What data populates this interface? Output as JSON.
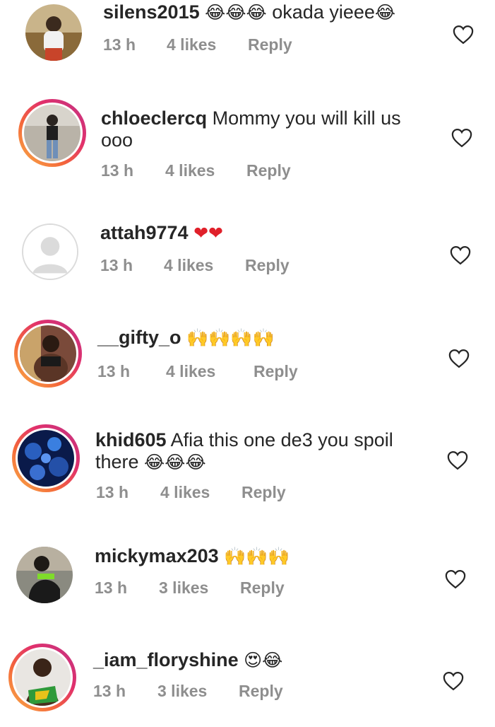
{
  "comments": [
    {
      "username": "silens2015",
      "text": " ",
      "emoji1": "😂😂😂",
      "text2": " okada yieee",
      "emoji2": "😂",
      "time": "13 h",
      "likes": "4 likes",
      "reply": "Reply"
    },
    {
      "username": "chloeclercq",
      "text": " Mommy you will kill us ooo",
      "emoji1": "",
      "text2": "",
      "emoji2": "",
      "time": "13 h",
      "likes": "4 likes",
      "reply": "Reply"
    },
    {
      "username": "attah9774",
      "text": " ",
      "emoji1": "❤❤",
      "text2": "",
      "emoji2": "",
      "time": "13 h",
      "likes": "4 likes",
      "reply": "Reply"
    },
    {
      "username": "__gifty_o",
      "text": " ",
      "emoji1": "🙌🙌🙌🙌",
      "text2": "",
      "emoji2": "",
      "time": "13 h",
      "likes": "4 likes",
      "reply": "Reply"
    },
    {
      "username": "khid605",
      "text": " Afia this one de3 you spoil there ",
      "emoji1": "😂😂😂",
      "text2": "",
      "emoji2": "",
      "time": "13 h",
      "likes": "4 likes",
      "reply": "Reply"
    },
    {
      "username": "mickymax203",
      "text": " ",
      "emoji1": "🙌🙌🙌",
      "text2": "",
      "emoji2": "",
      "time": "13 h",
      "likes": "3 likes",
      "reply": "Reply"
    },
    {
      "username": "_iam_floryshine",
      "text": " ",
      "emoji1": "😍😂",
      "text2": "",
      "emoji2": "",
      "time": "13 h",
      "likes": "3 likes",
      "reply": "Reply"
    }
  ]
}
